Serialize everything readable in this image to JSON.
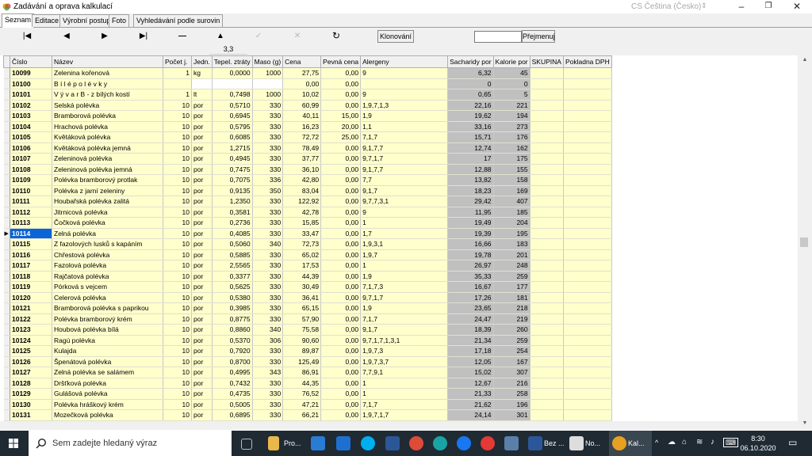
{
  "window": {
    "title": "Zadávání a oprava kalkulací",
    "language": "CS Čeština (Česko)",
    "controls": [
      "–",
      "❐",
      "✕"
    ]
  },
  "tabs": [
    "Seznam",
    "Editace",
    "Výrobní postup",
    "Foto",
    "Vyhledávání podle surovin"
  ],
  "toolbar": {
    "nav": [
      "|◀",
      "◀",
      "▶",
      "▶|",
      "—",
      "▲",
      "✓",
      "✕",
      "↻"
    ],
    "klonovani": "Klonování",
    "search_value": "",
    "prejmenuj": "Přejmenuj",
    "strip_value": "3,3"
  },
  "columns": [
    "Číslo",
    "Název",
    "Počet j.",
    "Jedn.",
    "Tepel. ztráty",
    "Maso (g)",
    "Cena",
    "Pevná cena",
    "Alergeny",
    "Sacharidy por",
    "Kalorie por",
    "SKUPINA",
    "Pokladna DPH"
  ],
  "rows": [
    [
      "10099",
      "Zelenina kořenová",
      "1",
      "kg",
      "0,0000",
      "1000",
      "27,75",
      "0,00",
      "9",
      "6,32",
      "45",
      "",
      ""
    ],
    [
      "10100",
      "B í l é  p o l é v k y",
      "",
      "",
      "",
      "",
      "0,00",
      "0,00",
      "",
      "0",
      "0",
      "",
      ""
    ],
    [
      "10101",
      "V ý v a r  B - z bílých kostí",
      "1",
      "lt",
      "0,7498",
      "1000",
      "10,02",
      "0,00",
      "9",
      "0,65",
      "5",
      "",
      ""
    ],
    [
      "10102",
      "Selská polévka",
      "10",
      "por",
      "0,5710",
      "330",
      "60,99",
      "0,00",
      "1,9,7,1,3",
      "22,16",
      "221",
      "",
      ""
    ],
    [
      "10103",
      "Bramborová polévka",
      "10",
      "por",
      "0,6945",
      "330",
      "40,11",
      "15,00",
      "1,9",
      "19,62",
      "194",
      "",
      ""
    ],
    [
      "10104",
      "Hrachová polévka",
      "10",
      "por",
      "0,5795",
      "330",
      "16,23",
      "20,00",
      "1,1",
      "33,16",
      "273",
      "",
      ""
    ],
    [
      "10105",
      "Květáková polévka",
      "10",
      "por",
      "0,6085",
      "330",
      "72,72",
      "25,00",
      "7,1,7",
      "15,71",
      "176",
      "",
      ""
    ],
    [
      "10106",
      "Květáková polévka jemná",
      "10",
      "por",
      "1,2715",
      "330",
      "78,49",
      "0,00",
      "9,1,7,7",
      "12,74",
      "162",
      "",
      ""
    ],
    [
      "10107",
      "Zeleninová polévka",
      "10",
      "por",
      "0,4945",
      "330",
      "37,77",
      "0,00",
      "9,7,1,7",
      "17",
      "175",
      "",
      ""
    ],
    [
      "10108",
      "Zeleninová polévka jemná",
      "10",
      "por",
      "0,7475",
      "330",
      "36,10",
      "0,00",
      "9,1,7,7",
      "12,88",
      "155",
      "",
      ""
    ],
    [
      "10109",
      "Polévka bramborový protlak",
      "10",
      "por",
      "0,7075",
      "336",
      "42,80",
      "0,00",
      "7,7",
      "13,82",
      "158",
      "",
      ""
    ],
    [
      "10110",
      "Polévka z jarní zeleniny",
      "10",
      "por",
      "0,9135",
      "350",
      "83,04",
      "0,00",
      "9,1,7",
      "18,23",
      "169",
      "",
      ""
    ],
    [
      "10111",
      "Houbařská polévka zalitá",
      "10",
      "por",
      "1,2350",
      "330",
      "122,92",
      "0,00",
      "9,7,7,3,1",
      "29,42",
      "407",
      "",
      ""
    ],
    [
      "10112",
      "Jitrnicová polévka",
      "10",
      "por",
      "0,3581",
      "330",
      "42,78",
      "0,00",
      "9",
      "11,95",
      "185",
      "",
      ""
    ],
    [
      "10113",
      "Čočková polévka",
      "10",
      "por",
      "0,2736",
      "330",
      "15,85",
      "0,00",
      "1",
      "19,49",
      "204",
      "",
      ""
    ],
    [
      "10114",
      "Zelná polévka",
      "10",
      "por",
      "0,4085",
      "330",
      "33,47",
      "0,00",
      "1,7",
      "19,39",
      "195",
      "",
      ""
    ],
    [
      "10115",
      "Z fazolových lusků s kapáním",
      "10",
      "por",
      "0,5060",
      "340",
      "72,73",
      "0,00",
      "1,9,3,1",
      "16,66",
      "183",
      "",
      ""
    ],
    [
      "10116",
      "Chřestová polévka",
      "10",
      "por",
      "0,5885",
      "330",
      "65,02",
      "0,00",
      "1,9,7",
      "19,78",
      "201",
      "",
      ""
    ],
    [
      "10117",
      "Fazolová polévka",
      "10",
      "por",
      "2,5565",
      "330",
      "17,53",
      "0,00",
      "1",
      "26,97",
      "248",
      "",
      ""
    ],
    [
      "10118",
      "Rajčatová polévka",
      "10",
      "por",
      "0,3377",
      "330",
      "44,39",
      "0,00",
      "1,9",
      "35,33",
      "259",
      "",
      ""
    ],
    [
      "10119",
      "Pórková s vejcem",
      "10",
      "por",
      "0,5625",
      "330",
      "30,49",
      "0,00",
      "7,1,7,3",
      "16,67",
      "177",
      "",
      ""
    ],
    [
      "10120",
      "Celerová polévka",
      "10",
      "por",
      "0,5380",
      "330",
      "36,41",
      "0,00",
      "9,7,1,7",
      "17,26",
      "181",
      "",
      ""
    ],
    [
      "10121",
      "Bramborová polévka s paprikou",
      "10",
      "por",
      "0,3985",
      "330",
      "65,15",
      "0,00",
      "1,9",
      "23,65",
      "218",
      "",
      ""
    ],
    [
      "10122",
      "Polévka bramborový krém",
      "10",
      "por",
      "0,8775",
      "330",
      "57,90",
      "0,00",
      "7,1,7",
      "24,47",
      "219",
      "",
      ""
    ],
    [
      "10123",
      "Houbová polévka bílá",
      "10",
      "por",
      "0,8860",
      "340",
      "75,58",
      "0,00",
      "9,1,7",
      "18,39",
      "260",
      "",
      ""
    ],
    [
      "10124",
      "Ragú polévka",
      "10",
      "por",
      "0,5370",
      "306",
      "90,60",
      "0,00",
      "9,7,1,7,1,3,1",
      "21,34",
      "259",
      "",
      ""
    ],
    [
      "10125",
      "Kulajda",
      "10",
      "por",
      "0,7920",
      "330",
      "89,87",
      "0,00",
      "1,9,7,3",
      "17,18",
      "254",
      "",
      ""
    ],
    [
      "10126",
      "Špenátová polévka",
      "10",
      "por",
      "0,8700",
      "330",
      "125,49",
      "0,00",
      "1,9,7,3,7",
      "12,05",
      "167",
      "",
      ""
    ],
    [
      "10127",
      "Zelná polévka se salámem",
      "10",
      "por",
      "0,4995",
      "343",
      "86,91",
      "0,00",
      "7,7,9,1",
      "15,02",
      "307",
      "",
      ""
    ],
    [
      "10128",
      "Dršťková polévka",
      "10",
      "por",
      "0,7432",
      "330",
      "44,35",
      "0,00",
      "1",
      "12,67",
      "216",
      "",
      ""
    ],
    [
      "10129",
      "Gulášová polévka",
      "10",
      "por",
      "0,4735",
      "330",
      "76,52",
      "0,00",
      "1",
      "21,33",
      "258",
      "",
      ""
    ],
    [
      "10130",
      "Polévka hráškový krém",
      "10",
      "por",
      "0,5005",
      "330",
      "47,21",
      "0,00",
      "7,1,7",
      "21,62",
      "196",
      "",
      ""
    ],
    [
      "10131",
      "Mozečková polévka",
      "10",
      "por",
      "0,6895",
      "330",
      "66,21",
      "0,00",
      "1,9,7,1,7",
      "24,14",
      "301",
      "",
      ""
    ]
  ],
  "selected_code": "10114",
  "taskbar": {
    "search_placeholder": "Sem zadejte hledaný výraz",
    "apps": [
      "Pro...",
      "Bez ...",
      "No...",
      "Kal..."
    ],
    "time": "8:30",
    "date": "06.10.2020"
  }
}
